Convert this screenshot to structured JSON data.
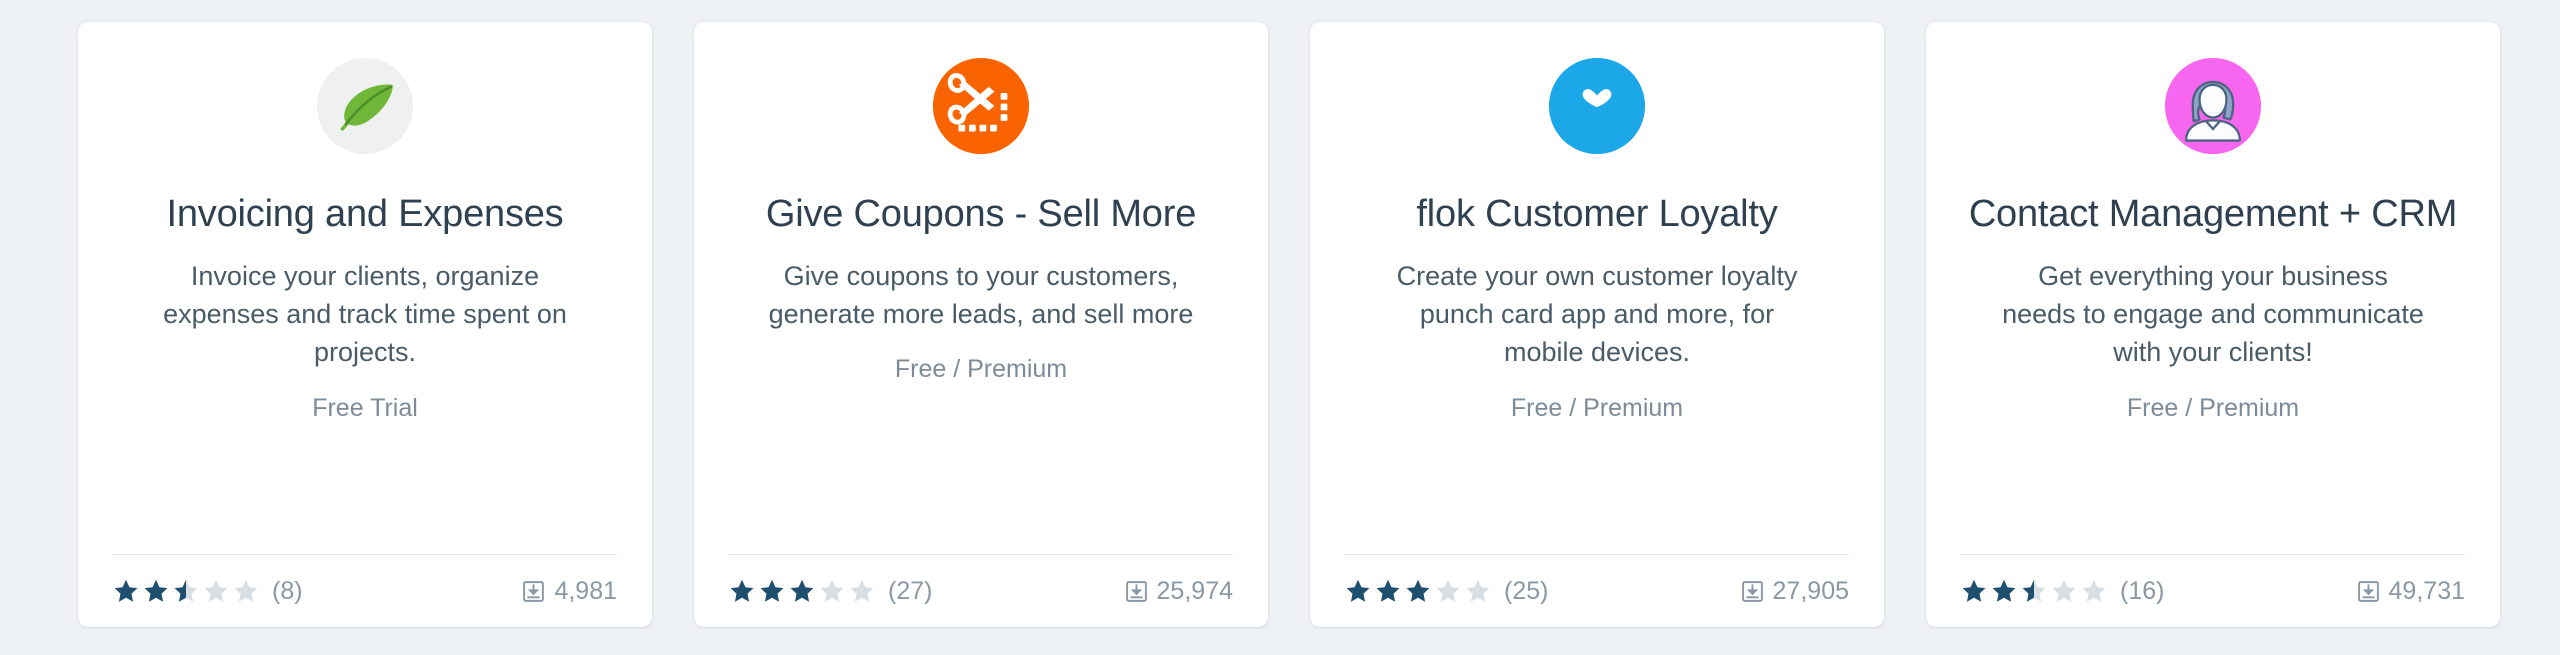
{
  "theme": {
    "page_background": "#eef1f4",
    "card_background": "#ffffff",
    "title_color": "#2f4050",
    "description_color": "#4a5b68",
    "price_color": "#7e8b98",
    "meta_color": "#8b98a4",
    "divider_color": "#e2e7ec",
    "star_filled_color": "#1f4f6e",
    "star_empty_color": "#d7dee4"
  },
  "app_cards": [
    {
      "icon": {
        "name": "leaf-icon",
        "circle_color": "#eff1f0",
        "mark_color": "#6fb639"
      },
      "title": "Invoicing and Expenses",
      "description": "Invoice your clients, organize expenses and track time spent on projects.",
      "price": "Free Trial",
      "rating": 2.5,
      "rating_count": "(8)",
      "installs": "4,981",
      "install_icon": "download-box-icon"
    },
    {
      "icon": {
        "name": "coupon-scissors-icon",
        "circle_color": "#fa6400",
        "mark_color": "#ffffff"
      },
      "title": "Give Coupons - Sell More",
      "description": "Give coupons to your customers, generate more leads, and sell more",
      "price": "Free / Premium",
      "rating": 3,
      "rating_count": "(27)",
      "installs": "25,974",
      "install_icon": "download-box-icon"
    },
    {
      "icon": {
        "name": "flok-heart-icon",
        "circle_color": "#1ca7e8",
        "mark_color": "#ffffff"
      },
      "title": "flok Customer Loyalty",
      "description": "Create your own customer loyalty punch card app and more, for mobile devices.",
      "price": "Free / Premium",
      "rating": 3,
      "rating_count": "(25)",
      "installs": "27,905",
      "install_icon": "download-box-icon"
    },
    {
      "icon": {
        "name": "contact-person-icon",
        "circle_color": "#f766ee",
        "mark_color": "#ffffff"
      },
      "title": "Contact Management + CRM",
      "description": "Get everything your business needs to engage and communicate with your clients!",
      "price": "Free / Premium",
      "rating": 2.5,
      "rating_count": "(16)",
      "installs": "49,731",
      "install_icon": "download-box-icon"
    }
  ]
}
